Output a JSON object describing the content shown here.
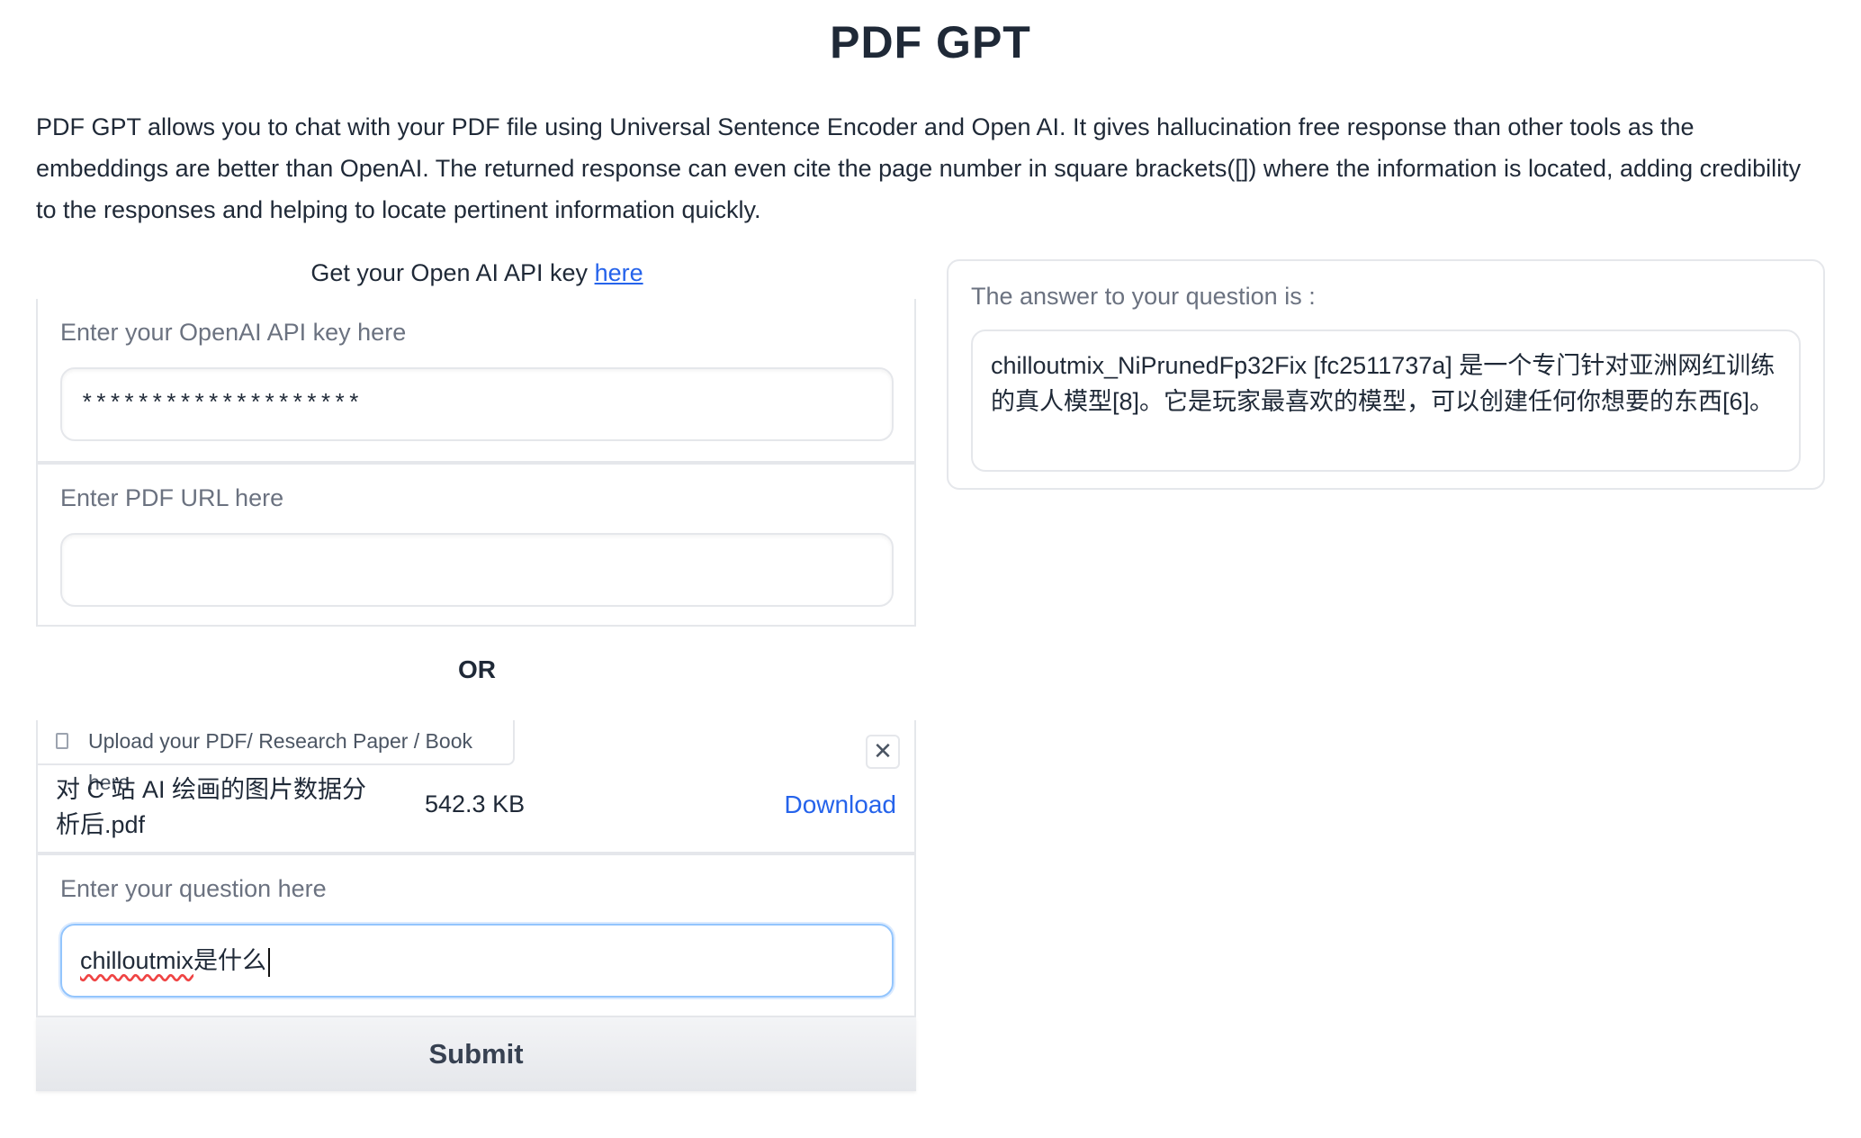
{
  "app": {
    "title": "PDF GPT",
    "description": "PDF GPT allows you to chat with your PDF file using Universal Sentence Encoder and Open AI. It gives hallucination free response than other tools as the embeddings are better than OpenAI. The returned response can even cite the page number in square brackets([]) where the information is located, adding credibility to the responses and helping to locate pertinent information quickly."
  },
  "left": {
    "api_key_prompt": "Get your Open AI API key ",
    "api_key_link": "here",
    "api_key_label": "Enter your OpenAI API key here",
    "api_key_value": "********************",
    "pdf_url_label": "Enter PDF URL here",
    "pdf_url_value": "",
    "or_label": "OR",
    "upload_label": "Upload your PDF/ Research Paper / Book here",
    "close_symbol": "✕",
    "file_name": "对 C 站 AI 绘画的图片数据分析后.pdf",
    "file_size": "542.3 KB",
    "download_label": "Download",
    "question_label": "Enter your question here",
    "question_value_latin": "chilloutmix",
    "question_value_cjk": "是什么",
    "submit_label": "Submit"
  },
  "right": {
    "answer_label": "The answer to your question is :",
    "answer_text": "chilloutmix_NiPrunedFp32Fix [fc2511737a] 是一个专门针对亚洲网红训练的真人模型[8]。它是玩家最喜欢的模型，可以创建任何你想要的东西[6]。"
  },
  "colors": {
    "link": "#2563eb",
    "focus_border": "#93c5fd",
    "border": "#e5e7eb"
  },
  "icons": {
    "upload": "file-icon",
    "close": "close-icon"
  }
}
